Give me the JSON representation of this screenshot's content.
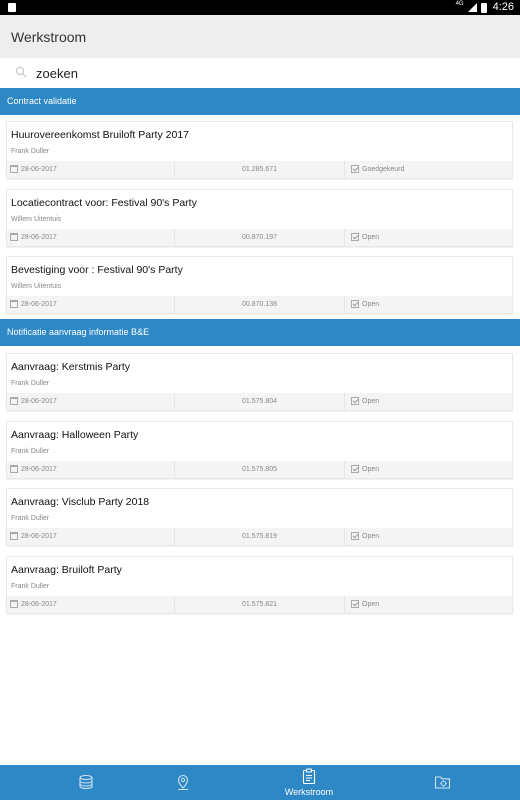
{
  "status_bar": {
    "network": "4G",
    "time": "4:26"
  },
  "app": {
    "title": "Werkstroom"
  },
  "search": {
    "placeholder": "zoeken"
  },
  "sections": [
    {
      "title": "Contract validatie",
      "items": [
        {
          "title": "Huurovereenkomst Bruiloft Party 2017",
          "person": "Frank Duller",
          "date": "28-06-2017",
          "number": "01.285.671",
          "status": "Goedgekeurd"
        },
        {
          "title": "Locatiecontract voor: Festival 90's Party",
          "person": "Willem Uitentuis",
          "date": "28-06-2017",
          "number": "00.870.197",
          "status": "Open"
        },
        {
          "title": "Bevestiging voor : Festival 90's Party",
          "person": "Willem Uitentuis",
          "date": "28-06-2017",
          "number": "00.870.138",
          "status": "Open"
        }
      ]
    },
    {
      "title": "Notificatie aanvraag informatie B&E",
      "items": [
        {
          "title": "Aanvraag: Kerstmis Party",
          "person": "Frank Duller",
          "date": "28-06-2017",
          "number": "01.575.804",
          "status": "Open"
        },
        {
          "title": "Aanvraag: Halloween Party",
          "person": "Frank Duller",
          "date": "28-06-2017",
          "number": "01.575.805",
          "status": "Open"
        },
        {
          "title": "Aanvraag: Visclub Party 2018",
          "person": "Frank Duller",
          "date": "28-06-2017",
          "number": "01.575.819",
          "status": "Open"
        },
        {
          "title": "Aanvraag: Bruiloft Party",
          "person": "Frank Duller",
          "date": "28-06-2017",
          "number": "01.575.821",
          "status": "Open"
        }
      ]
    }
  ],
  "bottom_nav": {
    "items": [
      {
        "icon": "database-icon",
        "label": ""
      },
      {
        "icon": "location-pin-icon",
        "label": ""
      },
      {
        "icon": "clipboard-icon",
        "label": "Werkstroom"
      },
      {
        "icon": "settings-folder-icon",
        "label": ""
      }
    ]
  },
  "colors": {
    "accent": "#2f88c6",
    "appbar": "#eeeeee",
    "footer_bg": "#f4f4f4"
  }
}
